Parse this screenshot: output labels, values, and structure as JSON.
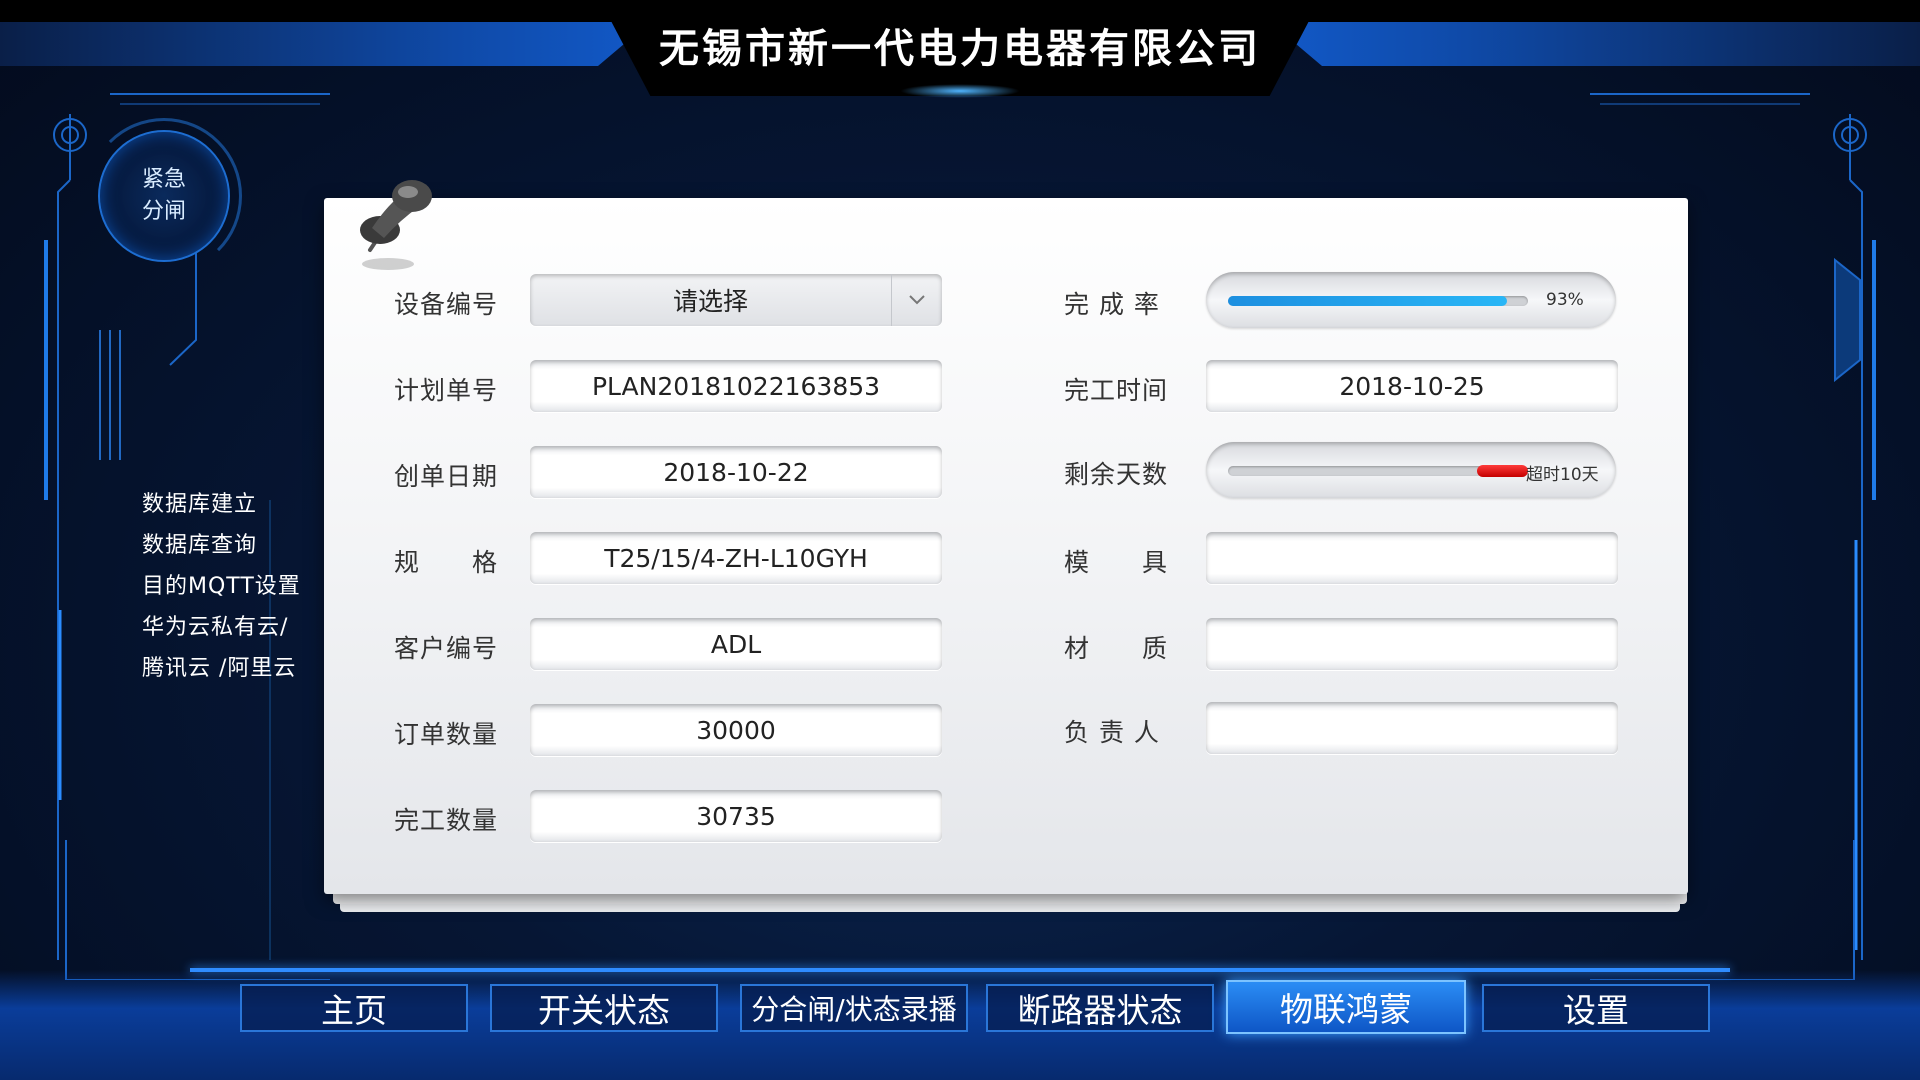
{
  "header": {
    "company": "无锡市新一代电力电器有限公司"
  },
  "emergency": {
    "line1": "紧急",
    "line2": "分闸"
  },
  "side_menu": [
    "数据库建立",
    "数据库查询",
    "目的MQTT设置",
    "华为云私有云/",
    "腾讯云 /阿里云"
  ],
  "form_left": [
    {
      "label": "设备编号",
      "value": "请选择",
      "type": "select"
    },
    {
      "label": "计划单号",
      "value": "PLAN20181022163853"
    },
    {
      "label": "创单日期",
      "value": "2018-10-22"
    },
    {
      "label": "规　　格",
      "value": "T25/15/4-ZH-L10GYH"
    },
    {
      "label": "客户编号",
      "value": "ADL"
    },
    {
      "label": "订单数量",
      "value": "30000"
    },
    {
      "label": "完工数量",
      "value": "30735"
    }
  ],
  "form_right": [
    {
      "label": "完 成 率",
      "value": "93%",
      "progress": 0.93
    },
    {
      "label": "完工时间",
      "value": "2018-10-25"
    },
    {
      "label": "剩余天数",
      "value": "超时10天",
      "progress": 0.17
    },
    {
      "label": "模　　具",
      "value": ""
    },
    {
      "label": "材　　质",
      "value": ""
    },
    {
      "label": "负 责 人",
      "value": ""
    }
  ],
  "nav": [
    "主页",
    "开关状态",
    "分合闸/状态录播",
    "断路器状态",
    "物联鸿蒙",
    "设置"
  ],
  "nav_active": "物联鸿蒙",
  "colors": {
    "accent": "#2f8cff",
    "progress_blue": "#1d8fe0",
    "overdue_red": "#d40000",
    "background": "#061634"
  }
}
